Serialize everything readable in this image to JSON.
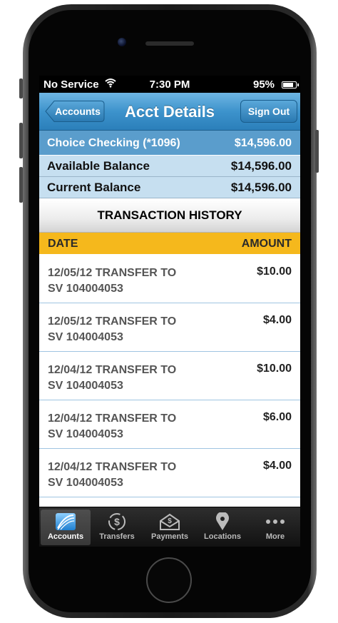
{
  "status_bar": {
    "carrier": "No Service",
    "time": "7:30 PM",
    "battery": "95%",
    "battery_level": 0.95
  },
  "nav": {
    "back_label": "Accounts",
    "title": "Acct Details",
    "sign_out_label": "Sign Out"
  },
  "account": {
    "name": "Choice Checking (*1096)",
    "balance": "$14,596.00"
  },
  "balances": [
    {
      "label": "Available Balance",
      "value": "$14,596.00"
    },
    {
      "label": "Current Balance",
      "value": "$14,596.00"
    }
  ],
  "history": {
    "title": "TRANSACTION HISTORY",
    "columns": {
      "date": "DATE",
      "amount": "AMOUNT"
    },
    "rows": [
      {
        "line1": "12/05/12 TRANSFER TO",
        "line2": "SV 104004053",
        "amount": "$10.00"
      },
      {
        "line1": "12/05/12 TRANSFER TO",
        "line2": "SV 104004053",
        "amount": "$4.00"
      },
      {
        "line1": "12/04/12 TRANSFER TO",
        "line2": "SV 104004053",
        "amount": "$10.00"
      },
      {
        "line1": "12/04/12 TRANSFER TO",
        "line2": "SV 104004053",
        "amount": "$6.00"
      },
      {
        "line1": "12/04/12 TRANSFER TO",
        "line2": "SV 104004053",
        "amount": "$4.00"
      }
    ]
  },
  "tabs": [
    {
      "label": "Accounts",
      "icon": "accounts-icon"
    },
    {
      "label": "Transfers",
      "icon": "transfers-icon"
    },
    {
      "label": "Payments",
      "icon": "payments-icon"
    },
    {
      "label": "Locations",
      "icon": "location-pin-icon"
    },
    {
      "label": "More",
      "icon": "more-dots-icon"
    }
  ],
  "colors": {
    "nav_blue": "#3d93cc",
    "account_blue": "#5a9dcc",
    "balance_bg": "#c6dff0",
    "column_header": "#f5b81c"
  }
}
